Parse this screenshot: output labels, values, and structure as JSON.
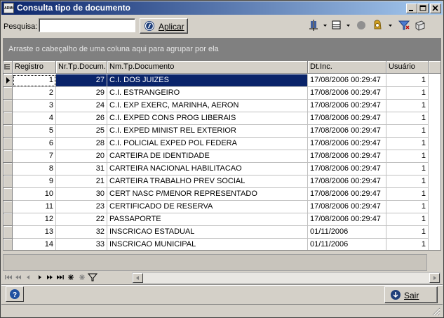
{
  "window": {
    "app_icon_text": "ADMi",
    "title": "Consulta tipo de documento"
  },
  "search": {
    "label": "Pesquisa:",
    "value": "",
    "placeholder": "",
    "apply_label": "Aplicar"
  },
  "group_panel": {
    "text": "Arraste o cabeçalho de uma coluna aqui para agrupar por ela"
  },
  "grid": {
    "columns": [
      "Registro",
      "Nr.Tp.Docum.",
      "Nm.Tp.Documento",
      "Dt.Inc.",
      "Usuário"
    ],
    "rows": [
      [
        "1",
        "27",
        "C.I. DOS JUIZES",
        "17/08/2006 00:29:47",
        "1"
      ],
      [
        "2",
        "29",
        "C.I. ESTRANGEIRO",
        "17/08/2006 00:29:47",
        "1"
      ],
      [
        "3",
        "24",
        "C.I. EXP EXERC, MARINHA, AERON",
        "17/08/2006 00:29:47",
        "1"
      ],
      [
        "4",
        "26",
        "C.I. EXPED CONS PROG LIBERAIS",
        "17/08/2006 00:29:47",
        "1"
      ],
      [
        "5",
        "25",
        "C.I. EXPED MINIST REL EXTERIOR",
        "17/08/2006 00:29:47",
        "1"
      ],
      [
        "6",
        "28",
        "C.I. POLICIAL EXPED POL FEDERA",
        "17/08/2006 00:29:47",
        "1"
      ],
      [
        "7",
        "20",
        "CARTEIRA DE IDENTIDADE",
        "17/08/2006 00:29:47",
        "1"
      ],
      [
        "8",
        "31",
        "CARTEIRA NACIONAL HABILITACAO",
        "17/08/2006 00:29:47",
        "1"
      ],
      [
        "9",
        "21",
        "CARTEIRA TRABALHO PREV SOCIAL",
        "17/08/2006 00:29:47",
        "1"
      ],
      [
        "10",
        "30",
        "CERT NASC P/MENOR REPRESENTADO",
        "17/08/2006 00:29:47",
        "1"
      ],
      [
        "11",
        "23",
        "CERTIFICADO DE RESERVA",
        "17/08/2006 00:29:47",
        "1"
      ],
      [
        "12",
        "22",
        "PASSAPORTE",
        "17/08/2006 00:29:47",
        "1"
      ],
      [
        "13",
        "32",
        "INSCRICAO ESTADUAL",
        "01/11/2006",
        "1"
      ],
      [
        "14",
        "33",
        "INSCRICAO MUNICIPAL",
        "01/11/2006",
        "1"
      ]
    ],
    "selected_row": 0
  },
  "navigator": {
    "icons": [
      "first-icon",
      "prev-page-icon",
      "prev-icon",
      "next-icon",
      "next-page-icon",
      "last-icon",
      "insert-icon",
      "delete-icon",
      "filter-icon"
    ]
  },
  "footer": {
    "exit_label": "Sair",
    "help_icon": "help-icon"
  },
  "colors": {
    "selection": "#0a246a",
    "title_start": "#0a246a",
    "title_end": "#a6caf0",
    "group_panel": "#808080"
  }
}
